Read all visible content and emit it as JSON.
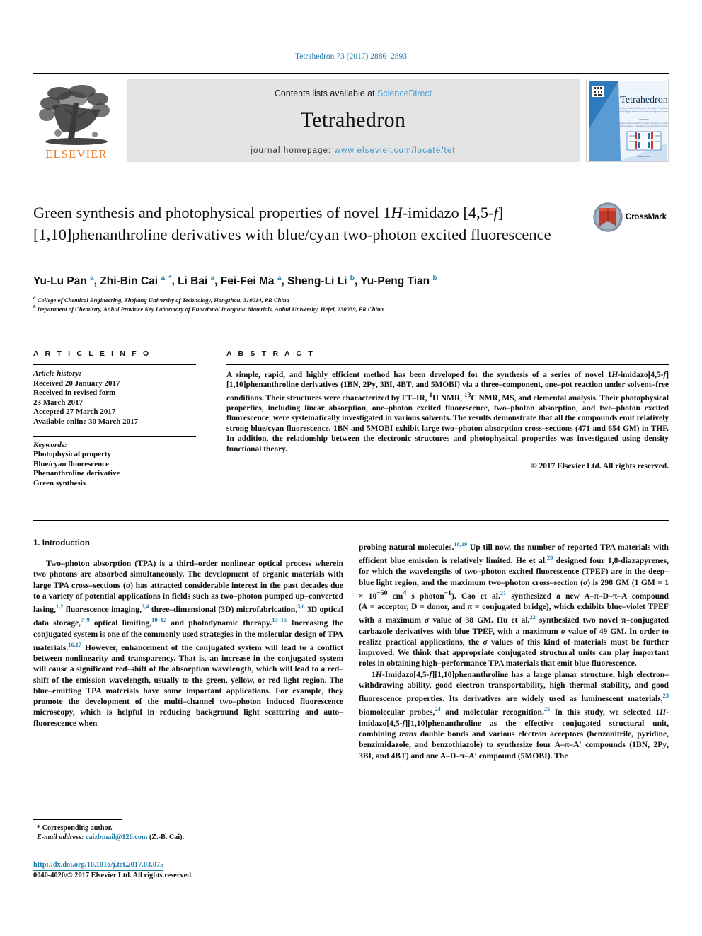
{
  "running_head": "Tetrahedron 73 (2017) 2886–2893",
  "masthead": {
    "publisher_logo_name": "elsevier-tree-logo",
    "publisher_word": "ELSEVIER",
    "contents_prefix": "Contents lists available at ",
    "contents_link": "ScienceDirect",
    "journal_name": "Tetrahedron",
    "homepage_prefix": "journal homepage: ",
    "homepage_url": "www.elsevier.com/locate/tet",
    "cover_title": "Tetrahedron"
  },
  "crossmark": {
    "label": "CrossMark"
  },
  "article": {
    "title_line1_a": "Green synthesis and photophysical properties of novel 1",
    "title_line1_italic": "H",
    "title_line1_b": "-imidazo",
    "title_line2_a": "[4,5-",
    "title_line2_italic": "f",
    "title_line2_b": "][1,10]phenanthroline derivatives with blue/cyan two-photon",
    "title_line3": "excited fluorescence",
    "authors": [
      {
        "name": "Yu-Lu Pan",
        "marks": "a"
      },
      {
        "name": "Zhi-Bin Cai",
        "marks": "a, *"
      },
      {
        "name": "Li Bai",
        "marks": "a"
      },
      {
        "name": "Fei-Fei Ma",
        "marks": "a"
      },
      {
        "name": "Sheng-Li Li",
        "marks": "b"
      },
      {
        "name": "Yu-Peng Tian",
        "marks": "b"
      }
    ],
    "affiliations": [
      {
        "mark": "a",
        "text": "College of Chemical Engineering, Zhejiang University of Technology, Hangzhou, 310014, PR China"
      },
      {
        "mark": "b",
        "text": "Department of Chemistry, Anhui Province Key Laboratory of Functional Inorganic Materials, Anhui University, Hefei, 230039, PR China"
      }
    ]
  },
  "article_info": {
    "heading": "A R T I C L E  I N F O",
    "history_label": "Article history:",
    "history": [
      "Received 20 January 2017",
      "Received in revised form",
      "23 March 2017",
      "Accepted 27 March 2017",
      "Available online 30 March 2017"
    ],
    "keywords_label": "Keywords:",
    "keywords": [
      "Photophysical property",
      "Blue/cyan fluorescence",
      "Phenanthroline derivative",
      "Green synthesis"
    ]
  },
  "abstract": {
    "heading": "A B S T R A C T",
    "paragraph_1": "A simple, rapid, and highly efficient method has been developed for the synthesis of a series of novel 1H-imidazo[4,5-f][1,10]phenanthroline derivatives (1BN, 2Py, 3BI, 4BT, and 5MOBI) via a three–component, one–pot reaction under solvent–free conditions. Their structures were characterized by FT–IR, 1H NMR, 13C NMR, MS, and elemental analysis. Their photophysical properties, including linear absorption, one–photon excited fluorescence, two–photon absorption, and two–photon excited fluorescence, were systematically investigated in various solvents. The results demonstrate that all the compounds emit relatively strong blue/cyan fluorescence. 1BN and 5MOBI exhibit large two–photon absorption cross–sections (471 and 654 GM) in THF. In addition, the relationship between the electronic structures and photophysical properties was investigated using density functional theory.",
    "copyright": "© 2017 Elsevier Ltd. All rights reserved."
  },
  "body": {
    "section_heading": "1.  Introduction",
    "left_para_1": "Two–photon absorption (TPA) is a third–order nonlinear optical process wherein two photons are absorbed simultaneously. The development of organic materials with large TPA cross–sections (σ) has attracted considerable interest in the past decades due to a variety of potential applications in fields such as two–photon pumped up–converted lasing,1,2 fluorescence imaging,3,4 three–dimensional (3D) microfabrication,5,6 3D optical data storage,7–9 optical limiting,10–12 and photodynamic therapy.13–15 Increasing the conjugated system is one of the commonly used strategies in the molecular design of TPA materials.16,17 However, enhancement of the conjugated system will lead to a conflict between nonlinearity and transparency. That is, an increase in the conjugated system will cause a significant red–shift of the absorption wavelength, which will lead to a red–shift of the emission wavelength, usually to the green, yellow, or red light region. The blue–emitting TPA materials have some important applications. For example, they promote the development of the multi–channel two–photon induced fluorescence microscopy, which is helpful in reducing background light scattering and auto–fluorescence when probing natural molecules.18,19",
    "right_para_1_cont": "Up till now, the number of reported TPA materials with efficient blue emission is relatively limited. He et al.20 designed four 1,8-diazapyrenes, for which the wavelengths of two–photon excited fluorescence (TPEF) are in the deep–blue light region, and the maximum two–photon cross–section (σ) is 298 GM (1 GM = 1 × 10−50 cm4 s photon−1). Cao et al.21 synthesized a new A–π–D–π–A compound (A = acceptor, D = donor, and π = conjugated bridge), which exhibits blue–violet TPEF with a maximum σ value of 38 GM. Hu et al.22 synthesized two novel π–conjugated carbazole derivatives with blue TPEF, with a maximum σ value of 49 GM. In order to realize practical applications, the σ values of this kind of materials must be further improved. We think that appropriate conjugated structural units can play important roles in obtaining high–performance TPA materials that emit blue fluorescence.",
    "right_para_2": "1H-Imidazo[4,5-f][1,10]phenanthroline has a large planar structure, high electron–withdrawing ability, good electron transportability, high thermal stability, and good fluorescence properties. Its derivatives are widely used as luminescent materials,23 biomolecular probes,24 and molecular recognition.25 In this study, we selected 1H-imidazo[4,5-f][1,10]phenanthroline as the effective conjugated structural unit, combining trans double bonds and various electron acceptors (benzonitrile, pyridine, benzimidazole, and benzothiazole) to synthesize four A–π–A′ compounds (1BN, 2Py, 3BI, and 4BT) and one A–D–π–A′ compound (5MOBI). The"
  },
  "footnotes": {
    "corresponding": "* Corresponding author.",
    "email_label": "E-mail address:",
    "email": "caizbmail@126.com",
    "email_suffix": "(Z.-B. Cai)."
  },
  "doc_footer": {
    "doi": "http://dx.doi.org/10.1016/j.tet.2017.03.075",
    "issn_line": "0040-4020/© 2017 Elsevier Ltd. All rights reserved."
  },
  "colors": {
    "link_blue": "#1c7aa8",
    "sciencedirect_blue": "#4aa0d5",
    "elsevier_orange": "#e87722",
    "banner_grey": "#e4e4e4",
    "crossmark_red": "#c0392b"
  }
}
